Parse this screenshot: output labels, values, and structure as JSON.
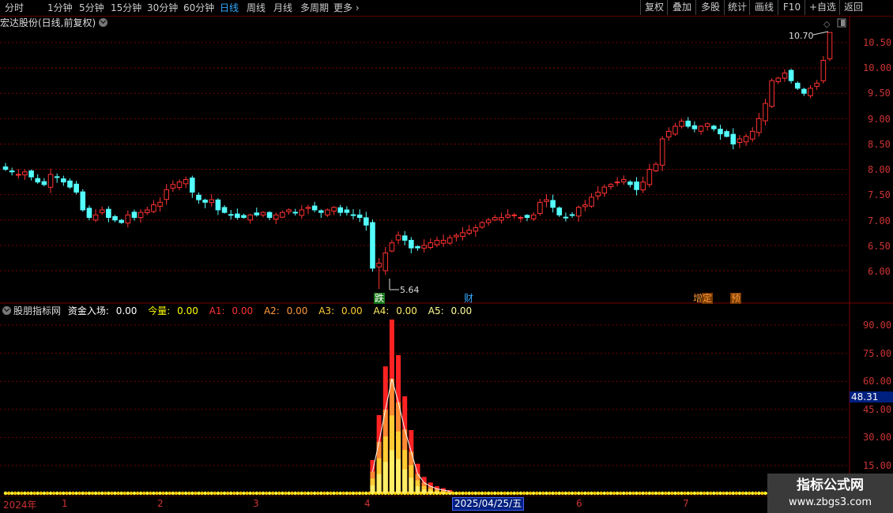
{
  "toolbar": {
    "periods": [
      "分时",
      "1分钟",
      "5分钟",
      "15分钟",
      "30分钟",
      "60分钟",
      "日线",
      "周线",
      "月线",
      "多周期",
      "更多"
    ],
    "active_period": "日线",
    "more_arrow": "›",
    "buttons": [
      "复权",
      "叠加",
      "多股",
      "统计",
      "画线",
      "F10",
      "+自选",
      "返回"
    ]
  },
  "main": {
    "title": "宏达股份(日线,前复权)",
    "high_label": "10.70",
    "low_label": "5.64",
    "y_ticks": [
      "10.50",
      "10.00",
      "9.50",
      "9.00",
      "8.50",
      "8.00",
      "7.50",
      "7.00",
      "6.50",
      "6.00"
    ],
    "events": [
      {
        "text": "跌",
        "color": "#ffffff",
        "bg": "#1a7a1a"
      },
      {
        "text": "财",
        "color": "#3af",
        "bg": "#000000"
      },
      {
        "text": "增",
        "color": "#ff9a3a",
        "bg": "#000000"
      },
      {
        "text": "定",
        "color": "#ff9a3a",
        "bg": "#7a3a00"
      },
      {
        "text": "预",
        "color": "#ff9a3a",
        "bg": "#7a3a00"
      }
    ],
    "colors": {
      "up": "#ff3232",
      "down": "#54ffff",
      "grid": "#7a0000"
    }
  },
  "indicator": {
    "name": "股朋指标网",
    "items": [
      {
        "label": "资金入场:",
        "value": "0.00",
        "color": "#ffffff"
      },
      {
        "label": "今量:",
        "value": "0.00",
        "color": "#ffff00"
      },
      {
        "label": "A1:",
        "value": "0.00",
        "color": "#ff3232"
      },
      {
        "label": "A2:",
        "value": "0.00",
        "color": "#ff9a3a"
      },
      {
        "label": "A3:",
        "value": "0.00",
        "color": "#ffcc33"
      },
      {
        "label": "A4:",
        "value": "0.00",
        "color": "#ffee66"
      },
      {
        "label": "A5:",
        "value": "0.00",
        "color": "#ffff99"
      }
    ],
    "y_ticks": [
      "90.00",
      "75.00",
      "60.00",
      "45.00",
      "30.00",
      "15.00"
    ],
    "current_value": "48.31"
  },
  "dates": {
    "year": "2024年",
    "months": [
      "1",
      "2",
      "3",
      "4",
      "5",
      "6",
      "7"
    ],
    "selected": "2025/04/25/五"
  },
  "watermark": {
    "line1": "指标公式网",
    "line2": "www.zbgs3.com"
  },
  "chart_data": {
    "type": "candlestick",
    "series": [
      {
        "name": "price",
        "close": [
          8.0,
          7.95,
          7.9,
          7.95,
          7.85,
          7.75,
          7.7,
          7.9,
          7.85,
          7.75,
          7.65,
          7.55,
          7.2,
          7.05,
          7.1,
          7.2,
          7.05,
          7.0,
          6.95,
          7.1,
          7.05,
          7.15,
          7.2,
          7.3,
          7.35,
          7.6,
          7.7,
          7.75,
          7.8,
          7.55,
          7.4,
          7.35,
          7.4,
          7.2,
          7.15,
          7.1,
          7.05,
          7.05,
          7.1,
          7.1,
          7.15,
          7.05,
          7.1,
          7.15,
          7.2,
          7.15,
          7.2,
          7.25,
          7.2,
          7.15,
          7.2,
          7.25,
          7.15,
          7.15,
          7.1,
          7.05,
          6.9,
          6.05,
          6.15,
          6.35,
          6.55,
          6.7,
          6.6,
          6.45,
          6.45,
          6.5,
          6.55,
          6.6,
          6.6,
          6.65,
          6.7,
          6.75,
          6.8,
          6.85,
          6.95,
          7.0,
          7.05,
          7.05,
          7.1,
          7.1,
          7.05,
          7.05,
          7.1,
          7.35,
          7.4,
          7.25,
          7.1,
          7.05,
          7.1,
          7.25,
          7.3,
          7.45,
          7.55,
          7.65,
          7.7,
          7.75,
          7.8,
          7.7,
          7.6,
          7.75,
          8.0,
          8.1,
          8.6,
          8.75,
          8.85,
          8.95,
          8.85,
          8.8,
          8.85,
          8.9,
          8.8,
          8.7,
          8.65,
          8.5,
          8.6,
          8.65,
          8.75,
          9.0,
          9.3,
          9.75,
          9.8,
          9.9,
          9.75,
          9.6,
          9.5,
          9.6,
          9.7,
          10.15,
          10.7
        ]
      }
    ],
    "ylim": [
      5.6,
      10.8
    ],
    "high": 10.7,
    "low": 5.64,
    "indicator_series": {
      "name": "资金入场",
      "values": [
        0,
        0,
        0,
        0,
        0,
        0,
        0,
        0,
        0,
        0,
        0,
        0,
        0,
        0,
        0,
        0,
        0,
        0,
        0,
        0,
        0,
        0,
        0,
        0,
        0,
        0,
        0,
        0,
        0,
        0,
        0,
        0,
        0,
        0,
        0,
        0,
        0,
        0,
        0,
        0,
        0,
        0,
        0,
        0,
        0,
        0,
        0,
        0,
        0,
        0,
        0,
        0,
        0,
        0,
        0,
        0,
        0,
        0,
        0,
        0,
        0,
        0,
        0,
        0,
        0,
        0,
        0,
        0,
        0,
        0,
        0,
        0,
        0,
        0,
        0,
        0,
        0,
        0,
        0,
        0,
        0,
        0,
        0,
        0,
        0,
        0,
        0,
        0,
        0,
        0,
        0,
        0,
        0,
        0,
        0,
        0,
        0,
        0,
        0,
        0,
        0,
        0,
        0,
        0,
        0,
        0,
        0,
        0,
        0,
        0,
        0,
        0,
        0,
        0,
        0,
        0,
        0,
        0,
        0,
        0,
        0,
        0,
        0,
        0,
        0,
        0
      ],
      "spike": [
        {
          "i": 57,
          "v": 18
        },
        {
          "i": 58,
          "v": 42
        },
        {
          "i": 59,
          "v": 68
        },
        {
          "i": 60,
          "v": 93
        },
        {
          "i": 61,
          "v": 74
        },
        {
          "i": 62,
          "v": 52
        },
        {
          "i": 63,
          "v": 34
        },
        {
          "i": 64,
          "v": 16
        },
        {
          "i": 65,
          "v": 9
        },
        {
          "i": 66,
          "v": 6
        },
        {
          "i": 67,
          "v": 4
        },
        {
          "i": 68,
          "v": 3
        },
        {
          "i": 69,
          "v": 2
        }
      ],
      "ylim": [
        0,
        100
      ]
    }
  }
}
